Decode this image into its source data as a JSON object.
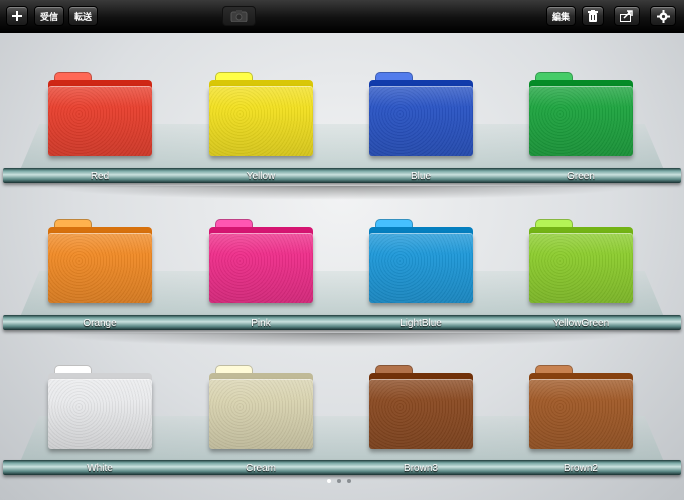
{
  "toolbar": {
    "add_icon": "plus-icon",
    "receive_label": "受信",
    "forward_label": "転送",
    "camera_icon": "camera-icon",
    "edit_label": "編集",
    "trash_icon": "trash-icon",
    "share_icon": "share-icon",
    "settings_icon": "gear-icon"
  },
  "folders": [
    {
      "label": "Red",
      "color": "#e8402e"
    },
    {
      "label": "Yellow",
      "color": "#f2e020"
    },
    {
      "label": "Blue",
      "color": "#2a54c4"
    },
    {
      "label": "Green",
      "color": "#1ea440"
    },
    {
      "label": "Orange",
      "color": "#f08a26"
    },
    {
      "label": "Pink",
      "color": "#ee2e8a"
    },
    {
      "label": "LightBlue",
      "color": "#1e98d8"
    },
    {
      "label": "YellowGreen",
      "color": "#8ccc2e"
    },
    {
      "label": "White",
      "color": "#e9eaec"
    },
    {
      "label": "Cream",
      "color": "#d9d3b0"
    },
    {
      "label": "Brown3",
      "color": "#8a4a22"
    },
    {
      "label": "Brown2",
      "color": "#a05a28"
    }
  ],
  "pagination": {
    "pages": 3,
    "current": 1
  }
}
